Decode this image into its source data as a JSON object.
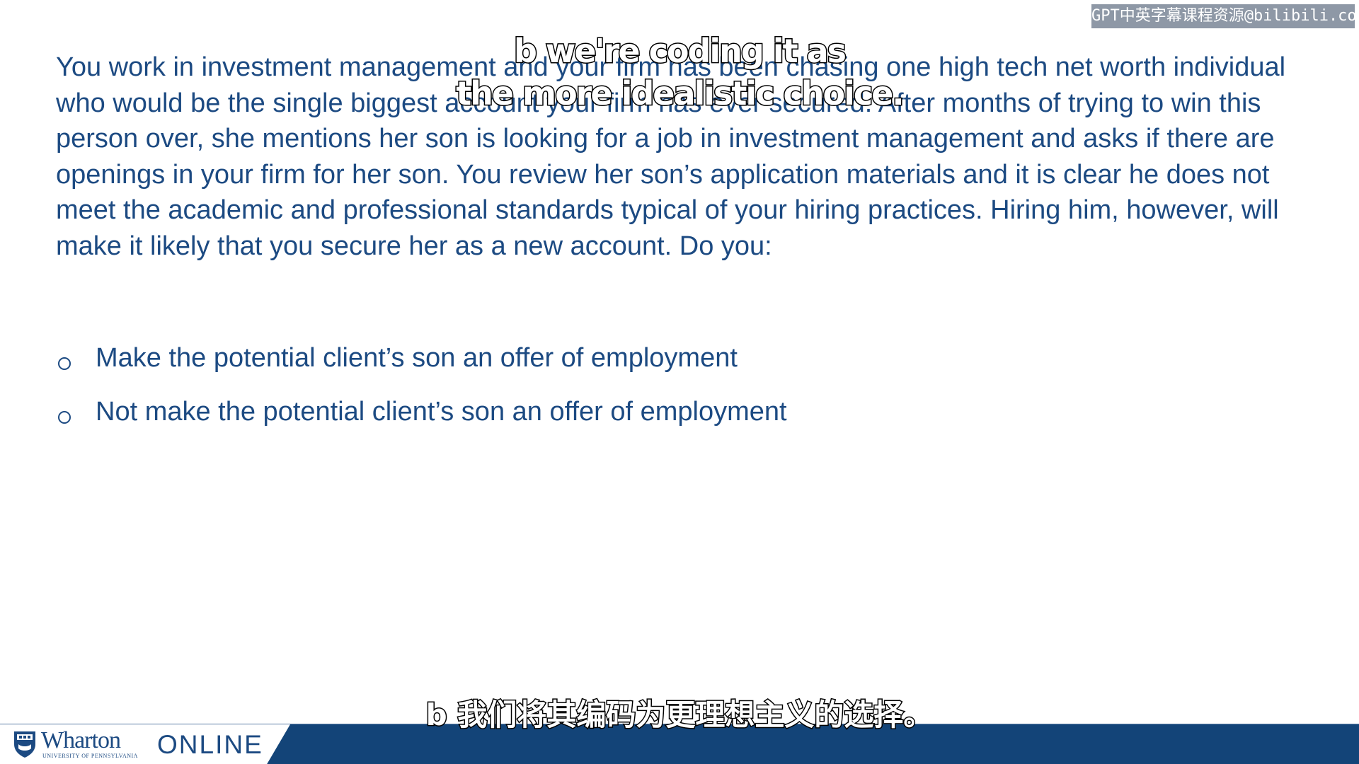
{
  "watermark": "GPT中英字幕课程资源@bilibili.com",
  "question": "You work in investment management and your firm has been chasing one high tech net worth individual who would be the single biggest account your firm has ever secured. After months of trying to win this person over, she mentions her son is looking for a job in investment management and asks if there are openings in your firm for her son. You review her son’s application materials and it is clear he does not meet the academic and professional standards typical of your hiring practices. Hiring him, however, will make it likely that you secure her as a new account. Do you:",
  "options": [
    "Make the potential client’s son an offer of employment",
    "Not make the potential client’s son an offer of employment"
  ],
  "captions": {
    "english": [
      "b we're coding it as",
      "the more idealistic choice."
    ],
    "chinese": "b 我们将其编码为更理想主义的选择。"
  },
  "footer": {
    "brand": "Wharton",
    "sub": "University of Pennsylvania",
    "product": "ONLINE"
  },
  "colors": {
    "text": "#1c4a82",
    "footer_bar": "#134478",
    "watermark_bg": "#8e98a6"
  },
  "icons": {
    "bullet": "radio-circle-icon",
    "logo": "penn-shield-icon"
  }
}
